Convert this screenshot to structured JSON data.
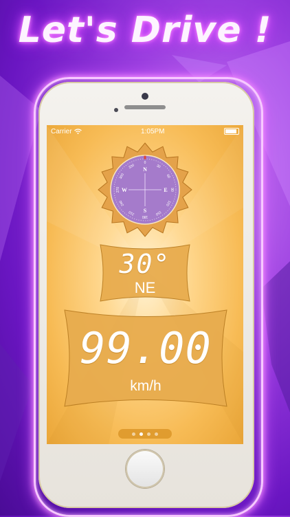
{
  "headline": "Let's Drive !",
  "status_bar": {
    "carrier": "Carrier",
    "time": "1:05PM"
  },
  "compass": {
    "cardinals": {
      "north": "N",
      "east": "E",
      "south": "S",
      "west": "W"
    },
    "ticks": [
      "0",
      "30",
      "60",
      "90",
      "120",
      "150",
      "180",
      "210",
      "240",
      "270",
      "300",
      "330"
    ],
    "heading_deg": 30
  },
  "heading": {
    "degrees": "30°",
    "direction": "NE"
  },
  "speed": {
    "value": "99.00",
    "unit": "km/h"
  },
  "pager": {
    "pages": 4,
    "active": 1
  },
  "icons": [
    "wifi-icon",
    "battery-icon",
    "compass-dial-icon",
    "home-button"
  ],
  "colors": {
    "background": "#7a22d0",
    "screen": "#f8c160",
    "compass_face": "#9b6ec2",
    "panel": "#e9b054",
    "glow": "#e25bff"
  }
}
